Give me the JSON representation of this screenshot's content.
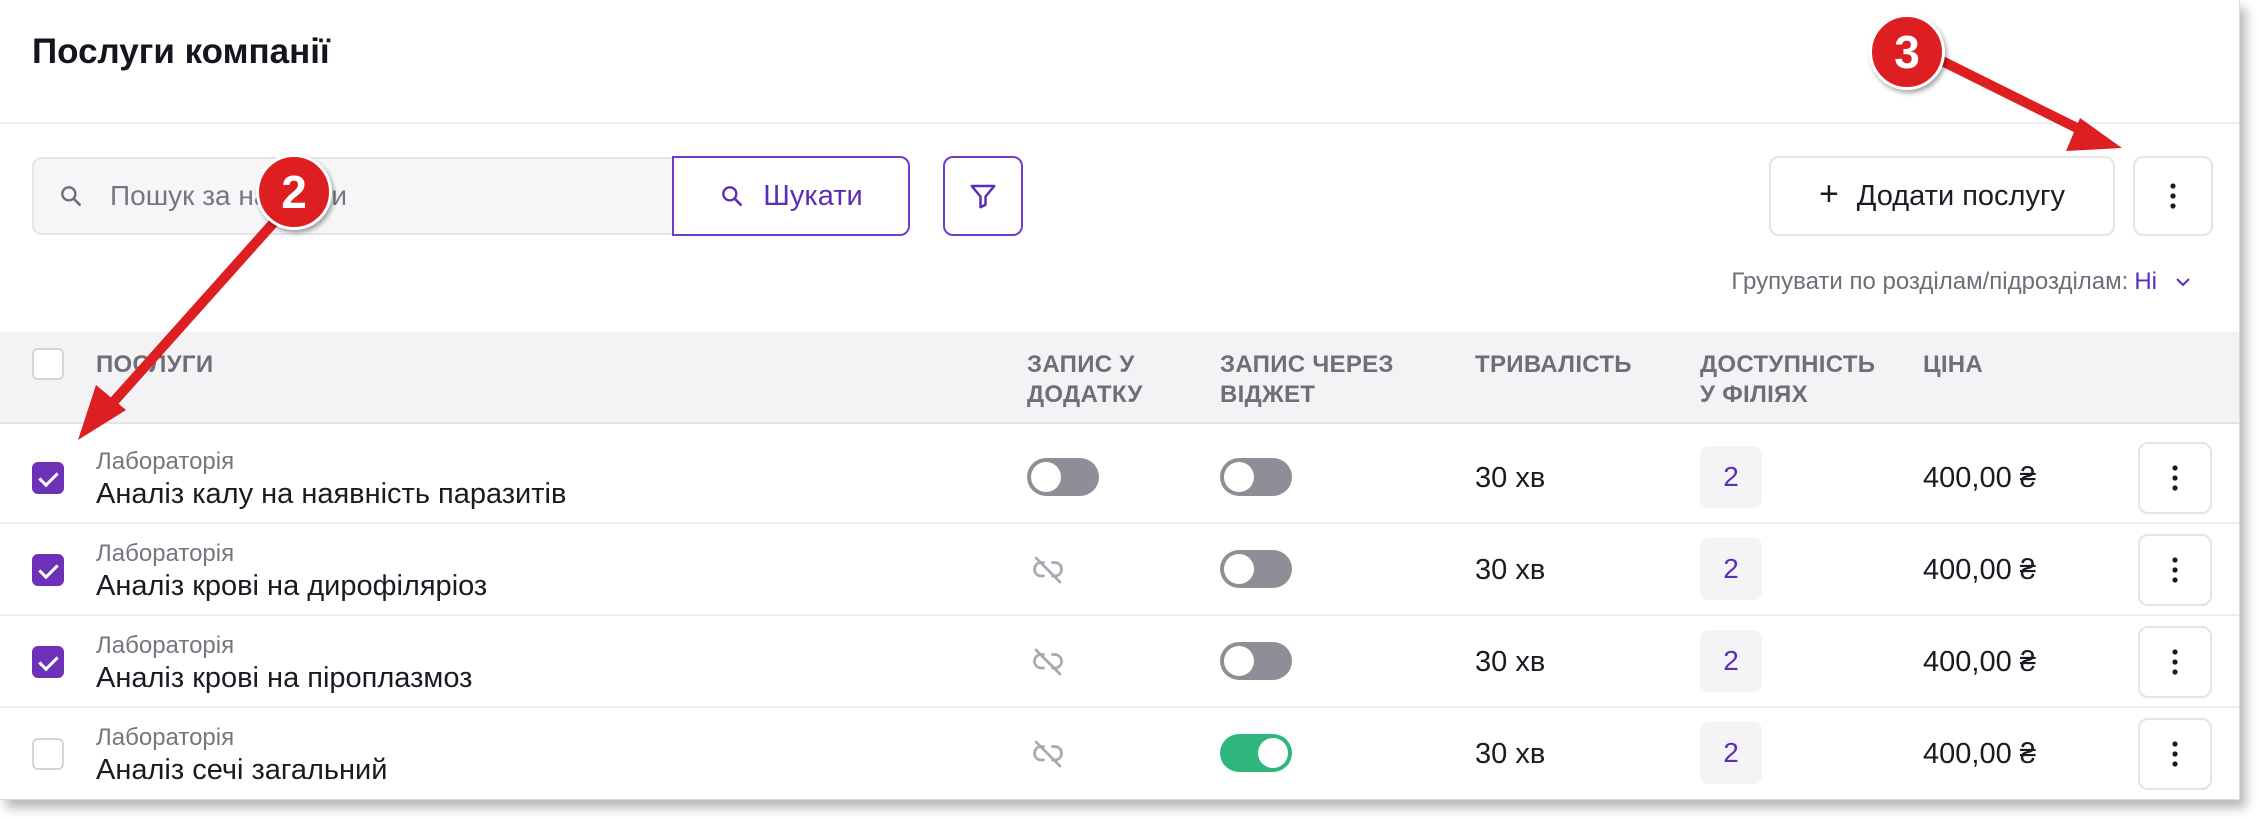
{
  "header": {
    "title": "Послуги компанії"
  },
  "search": {
    "placeholder": "Пошук за назвами",
    "button_label": "Шукати"
  },
  "toolbar": {
    "add_label": "Додати послугу"
  },
  "group_by": {
    "label": "Групувати по розділам/підрозділам:",
    "value": "Ні"
  },
  "table": {
    "columns": {
      "services": "ПОСЛУГИ",
      "app_booking_l1": "ЗАПИС У",
      "app_booking_l2": "ДОДАТКУ",
      "widget_booking_l1": "ЗАПИС ЧЕРЕЗ",
      "widget_booking_l2": "ВІДЖЕТ",
      "duration": "ТРИВАЛІСТЬ",
      "availability_l1": "ДОСТУПНІСТЬ",
      "availability_l2": "У ФІЛІЯХ",
      "price": "ЦІНА"
    },
    "rows": [
      {
        "category": "Лабораторія",
        "name": "Аналіз калу на наявність паразитів",
        "duration": "30 хв",
        "branches": "2",
        "price": "400,00 ₴",
        "checked": true,
        "app_booking": "toggle-off",
        "widget_booking": "toggle-off"
      },
      {
        "category": "Лабораторія",
        "name": "Аналіз крові на дирофіляріоз",
        "duration": "30 хв",
        "branches": "2",
        "price": "400,00 ₴",
        "checked": true,
        "app_booking": "unlink-icon",
        "widget_booking": "toggle-off"
      },
      {
        "category": "Лабораторія",
        "name": "Аналіз крові на піроплазмоз",
        "duration": "30 хв",
        "branches": "2",
        "price": "400,00 ₴",
        "checked": true,
        "app_booking": "unlink-icon",
        "widget_booking": "toggle-off"
      },
      {
        "category": "Лабораторія",
        "name": "Аналіз сечі загальний",
        "duration": "30 хв",
        "branches": "2",
        "price": "400,00 ₴",
        "checked": false,
        "app_booking": "unlink-icon",
        "widget_booking": "toggle-on"
      }
    ]
  },
  "annotations": {
    "badge_2": "2",
    "badge_3": "3"
  },
  "colors": {
    "accent": "#5c2eb8",
    "checkbox": "#6d31b8",
    "toggle_on": "#2fb67c",
    "annotation": "#dd1f22"
  }
}
